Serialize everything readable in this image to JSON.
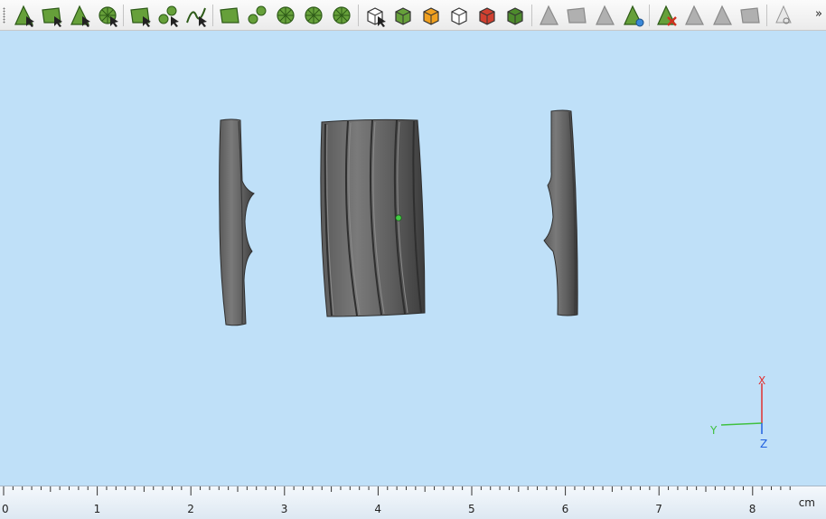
{
  "toolbar": {
    "overflow_label": "»",
    "buttons": [
      {
        "name": "select-vertex-icon",
        "color": "#66a03a"
      },
      {
        "name": "select-face-icon",
        "color": "#66a03a"
      },
      {
        "name": "select-edge-icon",
        "color": "#66a03a"
      },
      {
        "name": "select-circle-icon",
        "color": "#66a03a"
      },
      {
        "name": "select-rectangle-icon",
        "color": "#66a03a"
      },
      {
        "name": "select-blob-icon",
        "color": "#66a03a"
      },
      {
        "name": "select-curve-icon",
        "color": "#66a03a"
      },
      {
        "name": "mesh-face-icon",
        "color": "#66a03a"
      },
      {
        "name": "mesh-blob-icon",
        "color": "#66a03a"
      },
      {
        "name": "mesh-star-icon",
        "color": "#66a03a"
      },
      {
        "name": "mesh-wheel-icon",
        "color": "#66a03a"
      },
      {
        "name": "mesh-fan-icon",
        "color": "#66a03a"
      },
      {
        "name": "cube-select-icon",
        "color": "#ffffff"
      },
      {
        "name": "cube-green-icon",
        "color": "#66a03a"
      },
      {
        "name": "cube-orange-icon",
        "color": "#f0a020"
      },
      {
        "name": "cube-white-icon",
        "color": "#ffffff"
      },
      {
        "name": "cube-red-icon",
        "color": "#d04030"
      },
      {
        "name": "cube-dark-green-icon",
        "color": "#4d8a2c"
      },
      {
        "name": "vertex-gray-icon",
        "color": "#b0b0b0"
      },
      {
        "name": "face-gray-icon",
        "color": "#b0b0b0"
      },
      {
        "name": "edge-gray-icon",
        "color": "#b0b0b0"
      },
      {
        "name": "triangle-blue-icon",
        "color": "#66a03a"
      },
      {
        "name": "triangle-delete-icon",
        "color": "#66a03a"
      },
      {
        "name": "triangle-gray-icon",
        "color": "#b0b0b0"
      },
      {
        "name": "triangle-copy-icon",
        "color": "#b0b0b0"
      },
      {
        "name": "face-gray-2-icon",
        "color": "#b0b0b0"
      },
      {
        "name": "view-eye-icon",
        "color": "#b0b0b0"
      }
    ]
  },
  "axes": {
    "x_label": "X",
    "y_label": "Y",
    "z_label": "Z",
    "x_color": "#e03030",
    "y_color": "#40c040",
    "z_color": "#2060e0"
  },
  "ruler": {
    "unit": "cm",
    "labels": [
      "0",
      "1",
      "2",
      "3",
      "4",
      "5",
      "6",
      "7",
      "8"
    ]
  }
}
